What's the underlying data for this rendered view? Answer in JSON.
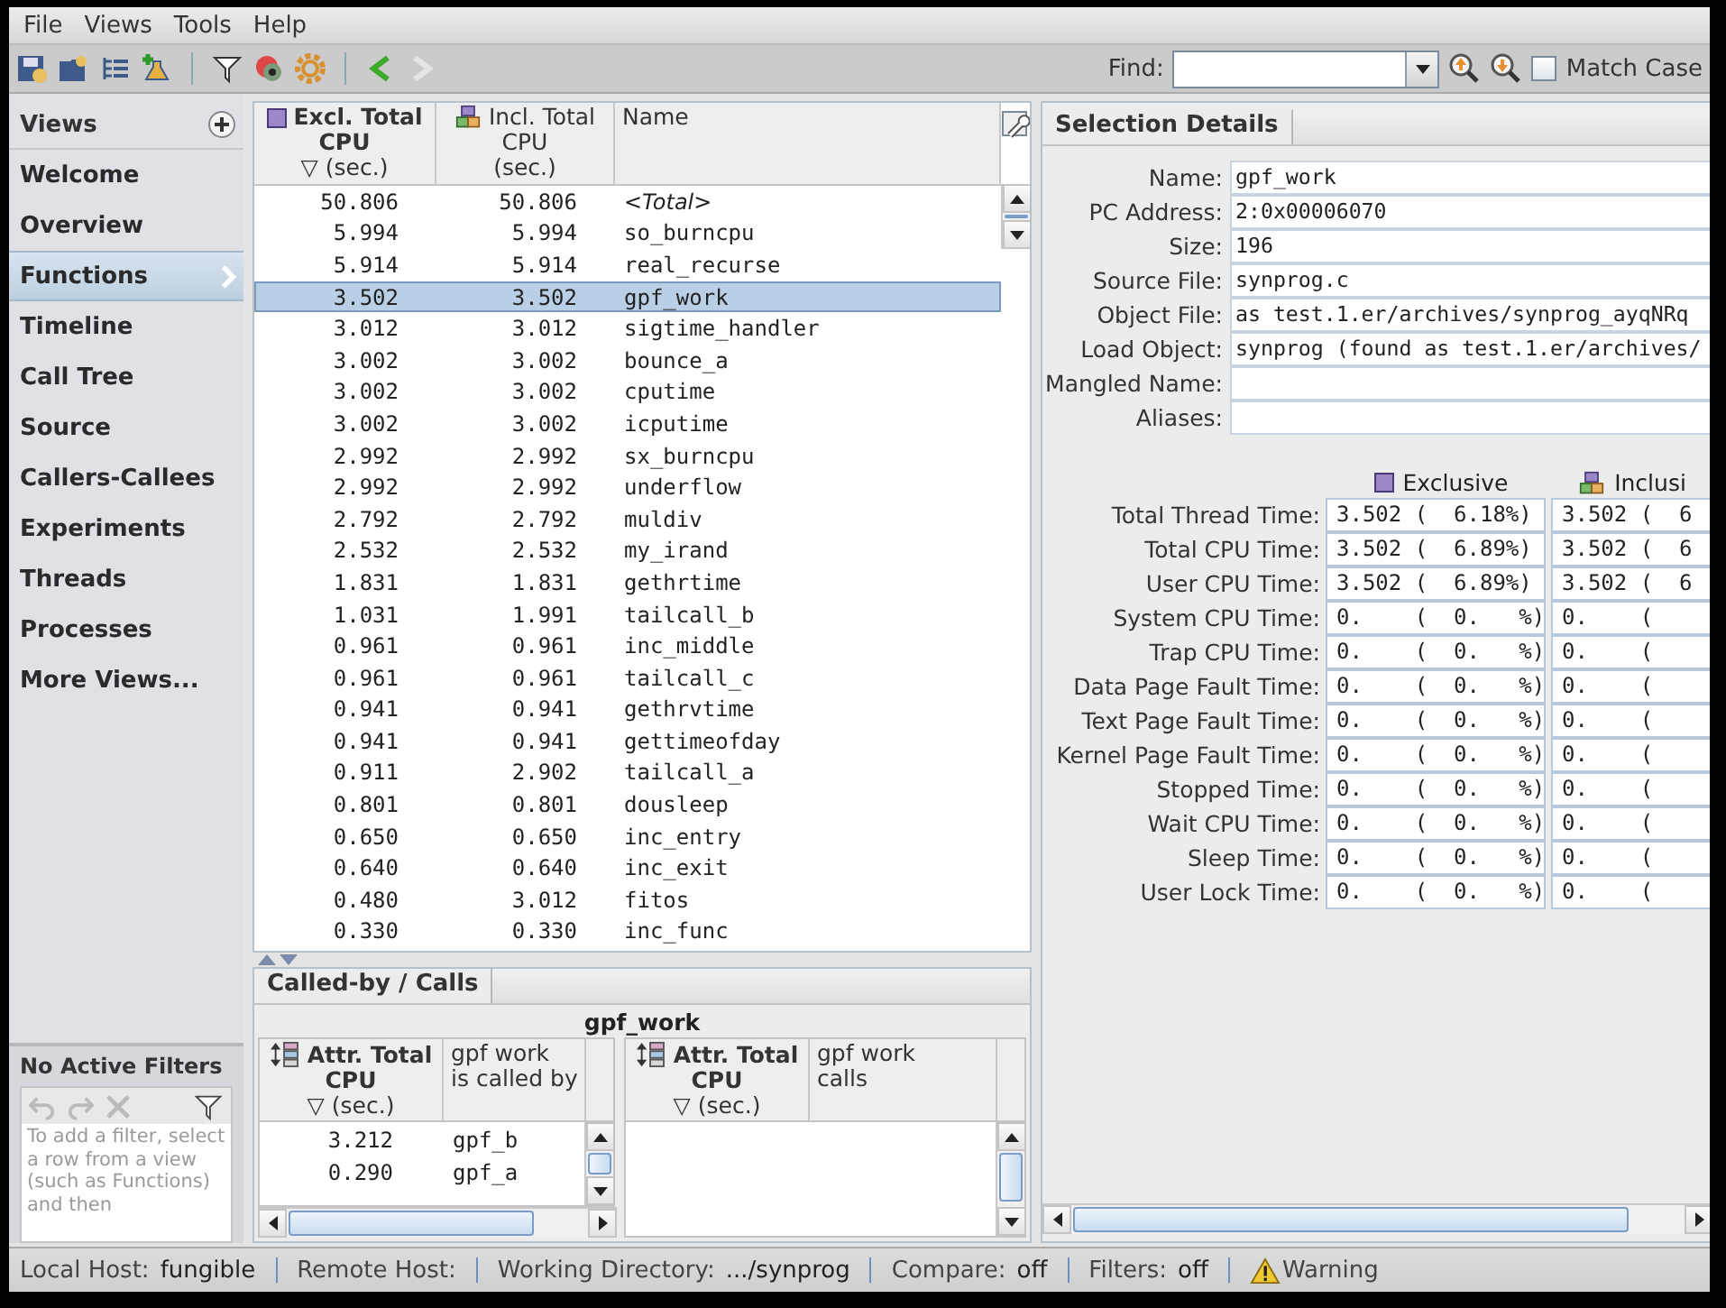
{
  "menu": [
    {
      "label": "File"
    },
    {
      "label": "Views"
    },
    {
      "label": "Tools"
    },
    {
      "label": "Help"
    }
  ],
  "toolbar": {
    "nav": [
      {
        "kind": "back",
        "disabled": false
      },
      {
        "kind": "forward",
        "disabled": true
      }
    ]
  },
  "find": {
    "label": "Find:",
    "match_case": {
      "label": "Match Case",
      "checked": false
    }
  },
  "sidebar": {
    "title": "Views",
    "items": [
      {
        "label": "Welcome",
        "selected": false
      },
      {
        "label": "Overview",
        "selected": false
      },
      {
        "label": "Functions",
        "selected": true
      },
      {
        "label": "Timeline",
        "selected": false
      },
      {
        "label": "Call Tree",
        "selected": false
      },
      {
        "label": "Source",
        "selected": false
      },
      {
        "label": "Callers-Callees",
        "selected": false
      },
      {
        "label": "Experiments",
        "selected": false
      },
      {
        "label": "Threads",
        "selected": false
      },
      {
        "label": "Processes",
        "selected": false
      },
      {
        "label": "More Views...",
        "selected": false
      }
    ]
  },
  "filters": {
    "title": "No Active Filters",
    "hint": "To add a filter, select a row from a view (such as Functions) and then"
  },
  "functions_table": {
    "columns": [
      {
        "kind": "exclusive",
        "lines": [
          "Excl. Total",
          "CPU",
          "(sec.)"
        ],
        "sorted": true,
        "sort_glyph": "▽"
      },
      {
        "kind": "inclusive",
        "lines": [
          "Incl. Total",
          "CPU",
          "(sec.)"
        ],
        "sorted": false
      },
      {
        "kind": "name",
        "lines": [
          "Name"
        ],
        "sorted": false
      }
    ],
    "rows": [
      {
        "excl": "50.806",
        "incl": "50.806",
        "name": "<Total>",
        "kind": "total",
        "selected": false
      },
      {
        "excl": "5.994",
        "incl": "5.994",
        "name": "so_burncpu",
        "kind": "function",
        "selected": false
      },
      {
        "excl": "5.914",
        "incl": "5.914",
        "name": "real_recurse",
        "kind": "function",
        "selected": false
      },
      {
        "excl": "3.502",
        "incl": "3.502",
        "name": "gpf_work",
        "kind": "function",
        "selected": true
      },
      {
        "excl": "3.012",
        "incl": "3.012",
        "name": "sigtime_handler",
        "kind": "function",
        "selected": false
      },
      {
        "excl": "3.002",
        "incl": "3.002",
        "name": "bounce_a",
        "kind": "function",
        "selected": false
      },
      {
        "excl": "3.002",
        "incl": "3.002",
        "name": "cputime",
        "kind": "function",
        "selected": false
      },
      {
        "excl": "3.002",
        "incl": "3.002",
        "name": "icputime",
        "kind": "function",
        "selected": false
      },
      {
        "excl": "2.992",
        "incl": "2.992",
        "name": "sx_burncpu",
        "kind": "function",
        "selected": false
      },
      {
        "excl": "2.992",
        "incl": "2.992",
        "name": "underflow",
        "kind": "function",
        "selected": false
      },
      {
        "excl": "2.792",
        "incl": "2.792",
        "name": "muldiv",
        "kind": "function",
        "selected": false
      },
      {
        "excl": "2.532",
        "incl": "2.532",
        "name": "my_irand",
        "kind": "function",
        "selected": false
      },
      {
        "excl": "1.831",
        "incl": "1.831",
        "name": "gethrtime",
        "kind": "function",
        "selected": false
      },
      {
        "excl": "1.031",
        "incl": "1.991",
        "name": "tailcall_b",
        "kind": "function",
        "selected": false
      },
      {
        "excl": "0.961",
        "incl": "0.961",
        "name": "inc_middle",
        "kind": "function",
        "selected": false
      },
      {
        "excl": "0.961",
        "incl": "0.961",
        "name": "tailcall_c",
        "kind": "function",
        "selected": false
      },
      {
        "excl": "0.941",
        "incl": "0.941",
        "name": "gethrvtime",
        "kind": "function",
        "selected": false
      },
      {
        "excl": "0.941",
        "incl": "0.941",
        "name": "gettimeofday",
        "kind": "function",
        "selected": false
      },
      {
        "excl": "0.911",
        "incl": "2.902",
        "name": "tailcall_a",
        "kind": "function",
        "selected": false
      },
      {
        "excl": "0.801",
        "incl": "0.801",
        "name": "dousleep",
        "kind": "function",
        "selected": false
      },
      {
        "excl": "0.650",
        "incl": "0.650",
        "name": "inc_entry",
        "kind": "function",
        "selected": false
      },
      {
        "excl": "0.640",
        "incl": "0.640",
        "name": "inc_exit",
        "kind": "function",
        "selected": false
      },
      {
        "excl": "0.480",
        "incl": "3.012",
        "name": "fitos",
        "kind": "function",
        "selected": false
      },
      {
        "excl": "0.330",
        "incl": "0.330",
        "name": "inc_func",
        "kind": "function",
        "selected": false
      }
    ]
  },
  "calls_panel": {
    "tab": "Called-by / Calls",
    "function": "gpf_work",
    "callers": {
      "metric_lines": [
        "Attr. Total",
        "CPU",
        "(sec.)"
      ],
      "sort_glyph": "▽",
      "name_lines": [
        "gpf work",
        "is called by"
      ],
      "rows": [
        {
          "value": "3.212",
          "name": "gpf_b"
        },
        {
          "value": "0.290",
          "name": "gpf_a"
        }
      ]
    },
    "callees": {
      "metric_lines": [
        "Attr. Total",
        "CPU",
        "(sec.)"
      ],
      "sort_glyph": "▽",
      "name_lines": [
        "gpf work",
        "calls"
      ]
    }
  },
  "details": {
    "tab": "Selection Details",
    "fields": [
      {
        "label": "Name:",
        "value": "gpf_work"
      },
      {
        "label": "PC Address:",
        "value": "2:0x00006070"
      },
      {
        "label": "Size:",
        "value": "196"
      },
      {
        "label": "Source File:",
        "value": "synprog.c"
      },
      {
        "label": "Object File:",
        "value": "as test.1.er/archives/synprog_ayqNRq"
      },
      {
        "label": "Load Object:",
        "value": "synprog (found as test.1.er/archives/"
      },
      {
        "label": "Mangled Name:"
      },
      {
        "label": "Aliases:"
      }
    ],
    "metric_columns": [
      {
        "kind": "exclusive",
        "label": "Exclusive"
      },
      {
        "kind": "inclusive",
        "label": "Inclusi"
      }
    ],
    "metrics": [
      {
        "label": "Total Thread Time:",
        "exclusive": "3.502 (  6.18%)",
        "inclusive": "3.502 (  6"
      },
      {
        "label": "Total CPU Time:",
        "exclusive": "3.502 (  6.89%)",
        "inclusive": "3.502 (  6"
      },
      {
        "label": "User CPU Time:",
        "exclusive": "3.502 (  6.89%)",
        "inclusive": "3.502 (  6"
      },
      {
        "label": "System CPU Time:",
        "exclusive": "0.    (  0.   %)",
        "inclusive": "0.    ("
      },
      {
        "label": "Trap CPU Time:",
        "exclusive": "0.    (  0.   %)",
        "inclusive": "0.    ("
      },
      {
        "label": "Data Page Fault Time:",
        "exclusive": "0.    (  0.   %)",
        "inclusive": "0.    ("
      },
      {
        "label": "Text Page Fault Time:",
        "exclusive": "0.    (  0.   %)",
        "inclusive": "0.    ("
      },
      {
        "label": "Kernel Page Fault Time:",
        "exclusive": "0.    (  0.   %)",
        "inclusive": "0.    ("
      },
      {
        "label": "Stopped Time:",
        "exclusive": "0.    (  0.   %)",
        "inclusive": "0.    ("
      },
      {
        "label": "Wait CPU Time:",
        "exclusive": "0.    (  0.   %)",
        "inclusive": "0.    ("
      },
      {
        "label": "Sleep Time:",
        "exclusive": "0.    (  0.   %)",
        "inclusive": "0.    ("
      },
      {
        "label": "User Lock Time:",
        "exclusive": "0.    (  0.   %)",
        "inclusive": "0.    ("
      }
    ]
  },
  "status_bar": [
    {
      "kind": "field",
      "label": "Local Host:",
      "value": "fungible"
    },
    {
      "kind": "field",
      "label": "Remote Host:"
    },
    {
      "kind": "field",
      "label": "Working Directory:",
      "value": ".../synprog"
    },
    {
      "kind": "field",
      "label": "Compare:",
      "value": "off"
    },
    {
      "kind": "field",
      "label": "Filters:",
      "value": "off"
    },
    {
      "kind": "warning",
      "label": "Warning"
    }
  ]
}
